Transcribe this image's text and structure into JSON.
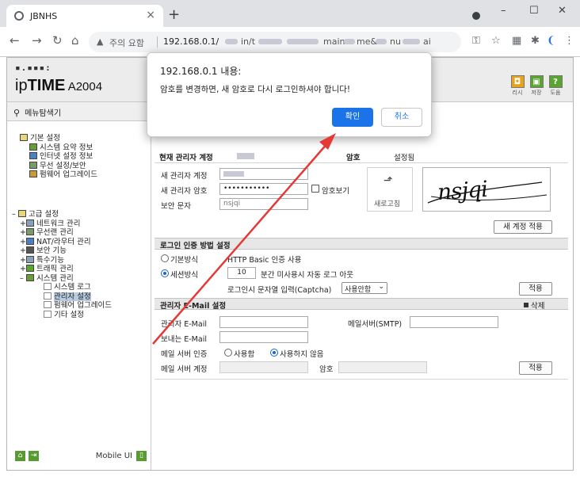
{
  "browser": {
    "tab_title": "JBNHS",
    "tab_close": "×",
    "new_tab": "+",
    "win_min": "–",
    "win_max": "☐",
    "win_close": "✕",
    "security_label": "주의 요함",
    "url": "192.168.0.1/",
    "url_parts": [
      "in/t",
      "main",
      "me&",
      "nu",
      "ai"
    ]
  },
  "header": {
    "logo_dots": "▪.▪▪▪:",
    "logo_ip": "ip",
    "logo_time": "TIME",
    "logo_model": " A2004",
    "icons": [
      {
        "glyph": "◘",
        "label": "리시",
        "color": "#e8a21c"
      },
      {
        "glyph": "▣",
        "label": "저장",
        "color": "#5aa531"
      },
      {
        "glyph": "?",
        "label": "도움",
        "color": "#5aa531"
      }
    ]
  },
  "sidebar": {
    "title": "메뉴탐색기",
    "basic": {
      "label": "기본 설정",
      "items": [
        "시스템 요약 정보",
        "인터넷 설정 정보",
        "무선 설정/보안",
        "펌웨어 업그레이드"
      ]
    },
    "advanced": {
      "label": "고급 설정",
      "items": [
        "네트워크 관리",
        "무선랜 관리",
        "NAT/라우터 관리",
        "보안 기능",
        "특수기능",
        "트래픽 관리",
        "시스템 관리"
      ]
    },
    "system": {
      "items": [
        "시스템 로그",
        "관리자 설정",
        "펌웨어 업그레이드",
        "기타 설정"
      ]
    },
    "mobile_ui": "Mobile UI"
  },
  "account": {
    "current_label": "현재 관리자 계정",
    "password_label": "암호",
    "password_status": "설정됨",
    "new_account_label": "새 관리자 계정",
    "new_password_label": "새 관리자 암호",
    "new_password_value": "•••••••••••",
    "show_password_label": "암호보기",
    "captcha_label": "보안 문자",
    "captcha_value": "nsjqi",
    "captcha_text": "nsjqi",
    "refresh_label": "새로고침",
    "apply_button": "새 계정 적용"
  },
  "login_auth": {
    "title": "로그인 인증 방법 설정",
    "basic_label": "기본방식",
    "basic_desc": "HTTP Basic 인증 사용",
    "session_label": "세션방식",
    "session_minutes": "10",
    "session_desc": "분간 미사용시 자동 로그 아웃",
    "captcha_label": "로그인시 문자열 입력(Captcha)",
    "captcha_option": "사용안함",
    "apply_button": "적용"
  },
  "email": {
    "title": "관리자 E-Mail 설정",
    "delete_label": "삭제",
    "admin_email_label": "관리자 E-Mail",
    "smtp_label": "메일서버(SMTP)",
    "sender_label": "보내는 E-Mail",
    "auth_label": "메일 서버 인증",
    "auth_on": "사용함",
    "auth_off": "사용하지 않음",
    "account_label": "메일 서버 계정",
    "password_label": "암호",
    "apply_button": "적용"
  },
  "dialog": {
    "title": "192.168.0.1 내용:",
    "message": "암호를 변경하면, 새 암호로 다시 로그인하셔야 합니다!",
    "ok": "확인",
    "cancel": "취소"
  },
  "colors": {
    "accent": "#1a73e8",
    "arrow": "#e53935",
    "selection": "#b8cbe0"
  }
}
